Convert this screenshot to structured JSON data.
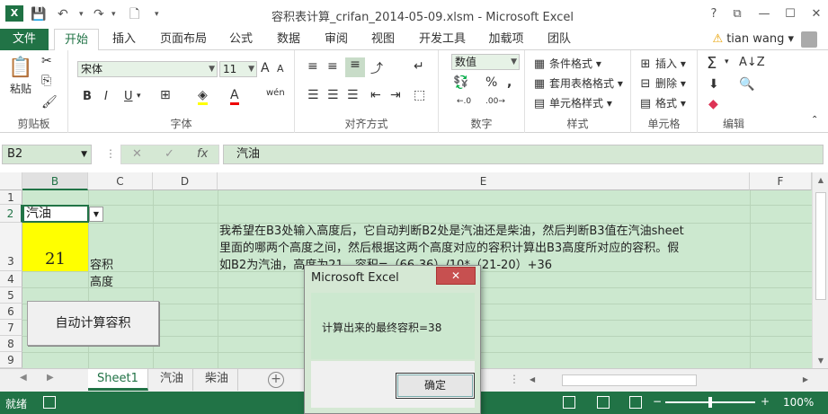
{
  "window": {
    "title": "容积表计算_crifan_2014-05-09.xlsm - Microsoft Excel",
    "logo": "X",
    "controls": [
      "?",
      "⧉",
      "—",
      "☐",
      "✕"
    ]
  },
  "ribbon_tabs": {
    "file": "文件",
    "tabs": [
      "开始",
      "插入",
      "页面布局",
      "公式",
      "数据",
      "审阅",
      "视图",
      "开发工具",
      "加载项",
      "团队"
    ],
    "active": "开始",
    "user": "tian wang"
  },
  "ribbon": {
    "clipboard": {
      "paste": "粘贴",
      "label": "剪贴板"
    },
    "font": {
      "name": "宋体",
      "size": "11",
      "label": "字体",
      "bold": "B",
      "italic": "I",
      "underline": "U",
      "grow": "A",
      "shrink": "A",
      "phonetic": "wén"
    },
    "alignment": {
      "label": "对齐方式"
    },
    "number": {
      "format": "数值",
      "label": "数字",
      "percent": "%",
      "comma": ","
    },
    "styles": {
      "conditional": "条件格式",
      "table": "套用表格格式",
      "cell": "单元格样式",
      "label": "样式"
    },
    "cells": {
      "insert": "插入",
      "delete": "删除",
      "format": "格式",
      "label": "单元格"
    },
    "editing": {
      "label": "编辑"
    }
  },
  "formula_bar": {
    "name_box": "B2",
    "fx": "fx",
    "cancel": "✕",
    "enter": "✓",
    "value": "汽油"
  },
  "grid": {
    "columns": [
      "B",
      "C",
      "D",
      "E",
      "F"
    ],
    "selected_column": "B",
    "rows": [
      "1",
      "2",
      "3",
      "4",
      "5",
      "6",
      "7",
      "8",
      "9"
    ],
    "selected_row": "2",
    "cells": {
      "B2": "汽油",
      "B3": "21",
      "C3": "容积",
      "C4": "高度"
    },
    "note_lines": [
      "我希望在B3处输入高度后，它自动判断B2处是汽油还是柴油，然后判断B3值在汽油sheet",
      "里面的哪两个高度之间，然后根据这两个高度对应的容积计算出B3高度所对应的容积。假",
      "如B2为汽油，高度为21，容积=（66-36）/10*（21-20）+36"
    ],
    "macro_button": "自动计算容积"
  },
  "sheets": {
    "tabs": [
      "Sheet1",
      "汽油",
      "柴油"
    ],
    "active": "Sheet1",
    "add": "+"
  },
  "status": {
    "text": "就绪",
    "zoom": "100%",
    "zoom_minus": "−",
    "zoom_plus": "+"
  },
  "dialog": {
    "title": "Microsoft Excel",
    "message": "计算出来的最终容积=38",
    "ok": "确定",
    "close": "✕"
  },
  "colors": {
    "accent": "#217346",
    "cell_bg": "#cce8cf",
    "highlight": "#ffff00"
  }
}
